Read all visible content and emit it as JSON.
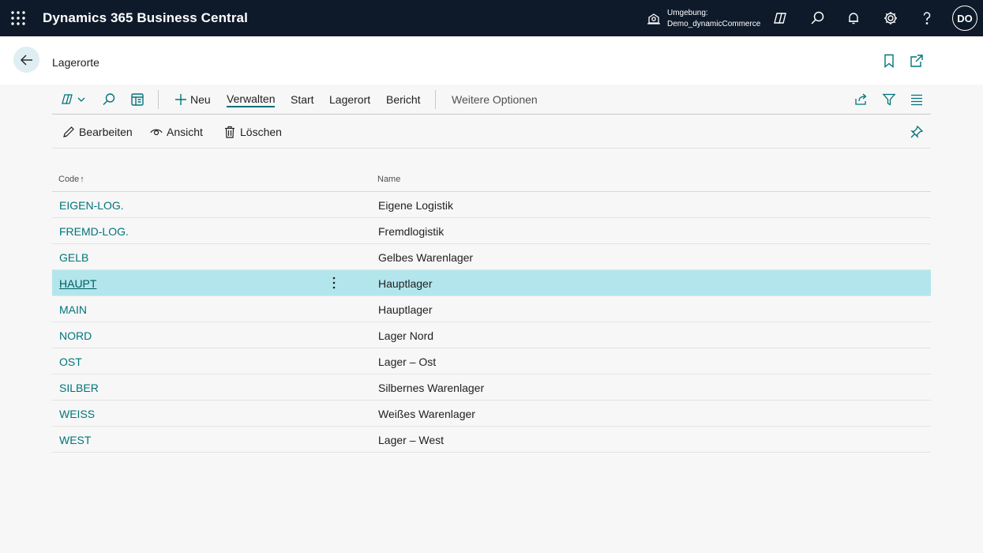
{
  "app": {
    "title": "Dynamics 365 Business Central",
    "environment_label": "Umgebung:",
    "environment_value": "Demo_dynamicCommerce",
    "avatar_initials": "DO"
  },
  "page": {
    "title": "Lagerorte"
  },
  "actions": {
    "new": "Neu",
    "manage": "Verwalten",
    "start": "Start",
    "location": "Lagerort",
    "report": "Bericht",
    "more": "Weitere Optionen"
  },
  "promoted": {
    "edit": "Bearbeiten",
    "view": "Ansicht",
    "delete": "Löschen"
  },
  "list": {
    "col_code": "Code",
    "sort_indicator": "↑",
    "col_name": "Name",
    "rows": [
      {
        "code": "EIGEN-LOG.",
        "name": "Eigene Logistik"
      },
      {
        "code": "FREMD-LOG.",
        "name": "Fremdlogistik"
      },
      {
        "code": "GELB",
        "name": "Gelbes Warenlager"
      },
      {
        "code": "HAUPT",
        "name": "Hauptlager"
      },
      {
        "code": "MAIN",
        "name": "Hauptlager"
      },
      {
        "code": "NORD",
        "name": "Lager Nord"
      },
      {
        "code": "OST",
        "name": "Lager – Ost"
      },
      {
        "code": "SILBER",
        "name": "Silbernes Warenlager"
      },
      {
        "code": "WEISS",
        "name": "Weißes Warenlager"
      },
      {
        "code": "WEST",
        "name": "Lager – West"
      }
    ],
    "selected_index": 3
  },
  "colors": {
    "topbar": "#0e1a2a",
    "accent": "#00747a",
    "selected_row": "#b3e6ec"
  }
}
